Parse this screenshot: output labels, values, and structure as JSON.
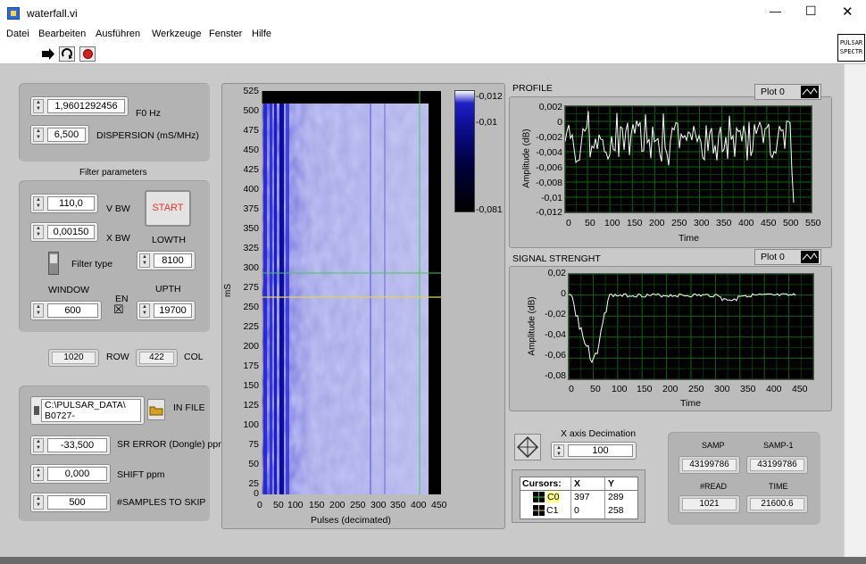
{
  "window": {
    "title": "waterfall.vi",
    "controls": {
      "minimize": "—",
      "maximize": "☐",
      "close": "✕"
    },
    "badge_line1": "PULSAR",
    "badge_line2": "SPECTR"
  },
  "menu": [
    "Datei",
    "Bearbeiten",
    "Ausführen",
    "Werkzeuge",
    "Fenster",
    "Hilfe"
  ],
  "left": {
    "f0": {
      "value": "1,9601292456",
      "label": "F0 Hz"
    },
    "dispersion": {
      "value": "6,500",
      "label": "DISPERSION (mS/MHz)"
    },
    "filter_title": "Filter parameters",
    "vbw": {
      "value": "110,0",
      "label": "V BW"
    },
    "xbw": {
      "value": "0,00150",
      "label": "X BW"
    },
    "start_label": "START",
    "lowth": {
      "label": "LOWTH",
      "value": "8100"
    },
    "filter_type_label": "Filter type",
    "window": {
      "label": "WINDOW",
      "value": "600"
    },
    "en_label": "EN",
    "en_check": "☒",
    "upth": {
      "label": "UPTH",
      "value": "19700"
    },
    "row": {
      "value": "1020",
      "label": "ROW"
    },
    "col": {
      "value": "422",
      "label": "COL"
    },
    "infile": {
      "line1": "C:\\PULSAR_DATA\\",
      "line2": "B0727-",
      "label": "IN FILE"
    },
    "srerror": {
      "value": "-33,500",
      "label": "SR ERROR (Dongle) ppm"
    },
    "shift": {
      "value": "0,000",
      "label": "SHIFT ppm"
    },
    "skip": {
      "value": "500",
      "label": "#SAMPLES TO SKIP"
    }
  },
  "waterfall": {
    "ylabel": "mS",
    "xlabel": "Pulses (decimated)",
    "yticks": [
      "525",
      "500",
      "475",
      "450",
      "425",
      "400",
      "375",
      "350",
      "325",
      "300",
      "275",
      "250",
      "225",
      "200",
      "175",
      "150",
      "125",
      "100",
      "75",
      "50",
      "25",
      "0"
    ],
    "xticks": [
      "0",
      "50",
      "100",
      "150",
      "200",
      "250",
      "300",
      "350",
      "400",
      "450"
    ],
    "colorbar": [
      "-0,012",
      "-0,01",
      "-0,081"
    ]
  },
  "profile": {
    "title": "PROFILE",
    "legend": "Plot 0",
    "ylabel": "Amplitude (dB)",
    "xlabel": "Time",
    "yticks": [
      "0,002",
      "0",
      "-0,002",
      "-0,004",
      "-0,006",
      "-0,008",
      "-0,01",
      "-0,012"
    ],
    "xticks": [
      "0",
      "50",
      "100",
      "150",
      "200",
      "250",
      "300",
      "350",
      "400",
      "450",
      "500",
      "550"
    ]
  },
  "signal": {
    "title": "SIGNAL STRENGHT",
    "legend": "Plot 0",
    "ylabel": "Amplitude (dB)",
    "xlabel": "Time",
    "yticks": [
      "0,02",
      "0",
      "-0,02",
      "-0,04",
      "-0,06",
      "-0,08"
    ],
    "xticks": [
      "0",
      "50",
      "100",
      "150",
      "200",
      "250",
      "300",
      "350",
      "400",
      "450"
    ]
  },
  "decimation": {
    "label": "X axis Decimation",
    "value": "100"
  },
  "cursors": {
    "headers": [
      "Cursors:",
      "X",
      "Y"
    ],
    "rows": [
      {
        "name": "C0",
        "x": "397",
        "y": "289"
      },
      {
        "name": "C1",
        "x": "0",
        "y": "258"
      }
    ]
  },
  "samp": {
    "samp_label": "SAMP",
    "samp_value": "43199786",
    "samp1_label": "SAMP-1",
    "samp1_value": "43199786",
    "read_label": "#READ",
    "read_value": "1021",
    "time_label": "TIME",
    "time_value": "21600.6"
  },
  "colors": {
    "accent_start": "#e33333",
    "waterfall_blue": "#3b3bd8",
    "plot_grid": "#0c6a0c",
    "cursor_c0": "#3cd03c",
    "cursor_c1": "#e8d24a"
  }
}
